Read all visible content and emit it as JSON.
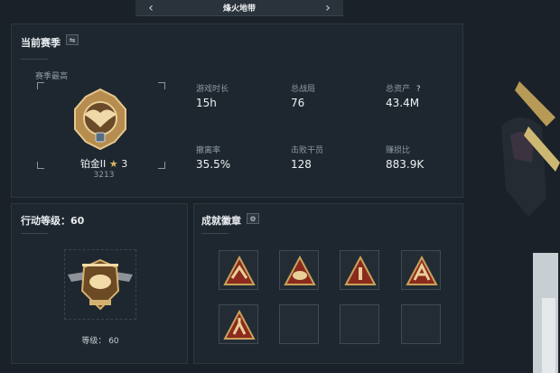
{
  "topbar": {
    "mode_title": "烽火地带"
  },
  "season": {
    "title": "当前赛季",
    "best_label": "赛季最高",
    "rank_name": "铂金II",
    "rank_stars": "3",
    "rank_points": "3213",
    "stats": [
      {
        "label": "游戏时长",
        "value": "15h"
      },
      {
        "label": "总战局",
        "value": "76"
      },
      {
        "label": "总资产",
        "value": "43.4M",
        "help": "?"
      },
      {
        "label": "撤离率",
        "value": "35.5%"
      },
      {
        "label": "击败干员",
        "value": "128"
      },
      {
        "label": "赚损比",
        "value": "883.9K"
      }
    ]
  },
  "action": {
    "title": "行动等级：60",
    "level_label": "等级： 60"
  },
  "achievements": {
    "title": "成就徽章",
    "badges": [
      "badge-1",
      "badge-2",
      "badge-3",
      "badge-4",
      "badge-5",
      "empty",
      "empty",
      "empty"
    ]
  },
  "colors": {
    "accent_gold": "#c9a25a",
    "badge_red": "#8b2a1d",
    "panel_bg": "#1e272f"
  }
}
